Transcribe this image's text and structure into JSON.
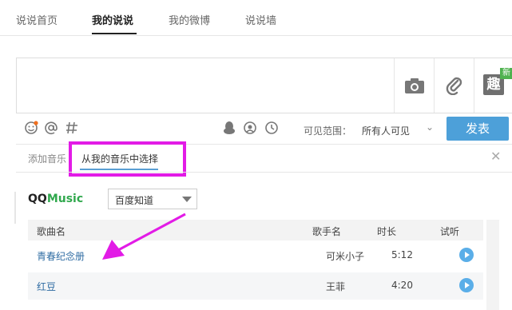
{
  "tabs": [
    {
      "label": "说说首页",
      "active": false
    },
    {
      "label": "我的说说",
      "active": true
    },
    {
      "label": "我的微博",
      "active": false
    },
    {
      "label": "说说墙",
      "active": false
    }
  ],
  "compose": {
    "media": [
      "camera-icon",
      "attachment-icon",
      "fun-icon"
    ],
    "fun_label": "趣",
    "new_badge": "新"
  },
  "toolbar": {
    "icons": [
      "emoji-icon",
      "mention-icon",
      "hashtag-icon",
      "qq-penguin-icon",
      "location-icon",
      "clock-icon"
    ],
    "visibility_label": "可见范围：",
    "visibility_value": "所有人可见",
    "publish_label": "发表"
  },
  "music": {
    "tabs": [
      {
        "label": "添加音乐",
        "active": false
      },
      {
        "label": "从我的音乐中选择",
        "active": true
      }
    ],
    "logo_qq": "QQ",
    "logo_music": "Music",
    "source_value": "百度知道",
    "columns": {
      "song": "歌曲名",
      "artist": "歌手名",
      "duration": "时长",
      "preview": "试听"
    },
    "rows": [
      {
        "song": "青春纪念册",
        "artist": "可米小子",
        "duration": "5:12"
      },
      {
        "song": "红豆",
        "artist": "王菲",
        "duration": "4:20"
      }
    ]
  },
  "colors": {
    "accent": "#4da0d9",
    "highlight": "#e21be6",
    "qqmusic_green": "#30a84d"
  }
}
